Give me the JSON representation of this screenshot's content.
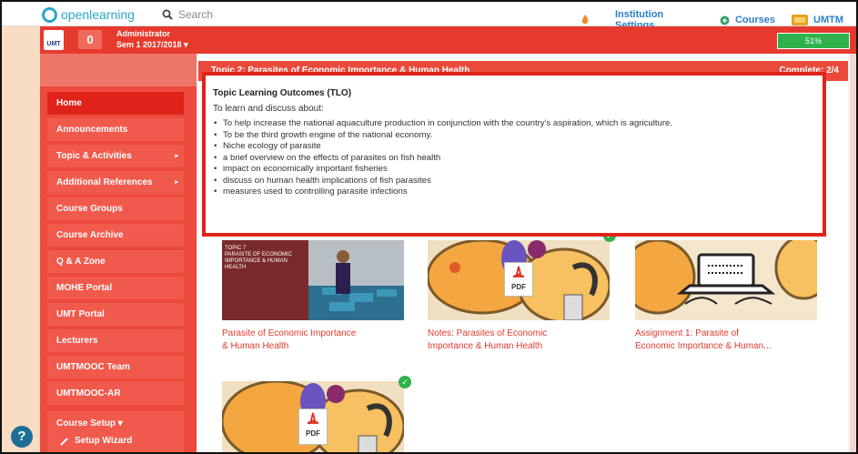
{
  "topbar": {
    "brand": "openlearning",
    "search_placeholder": "Search",
    "institution_settings": "Institution Settings",
    "courses": "Courses",
    "umtm": "UMTM"
  },
  "user": {
    "role": "Administrator",
    "semester": "Sem 1 2017/2018 ▾",
    "notifications": "0",
    "logo_text": "UMT",
    "progress": "51%"
  },
  "sidebar": {
    "items": [
      {
        "label": "Home",
        "active": true
      },
      {
        "label": "Announcements"
      },
      {
        "label": "Topic & Activities",
        "arrow": "▸"
      },
      {
        "label": "Additional References",
        "arrow": "▸"
      },
      {
        "label": "Course Groups"
      },
      {
        "label": "Course Archive"
      },
      {
        "label": "Q & A Zone"
      },
      {
        "label": "MOHE Portal"
      },
      {
        "label": "UMT Portal"
      },
      {
        "label": "Lecturers"
      },
      {
        "label": "UMTMOOC Team"
      },
      {
        "label": "UMTMOOC-AR"
      }
    ],
    "setup": "Course Setup ▾",
    "setup_wizard": "Setup Wizard",
    "help": "?"
  },
  "topic_bar": {
    "title": "Topic 2: Parasites of Economic Importance & Human Health",
    "complete": "Complete: 2/4"
  },
  "tlo": {
    "title": "Topic Learning Outcomes (TLO)",
    "intro": "To learn and discuss about:",
    "items": [
      "To help increase the national aquaculture production in conjunction with the country's aspiration, which is agriculture.",
      "To be the third growth engine of the national economy.",
      "Niche ecology of parasite",
      "a brief overview on the effects of parasites on fish health",
      "impact on economically important fisheries",
      "discuss on human health implications of fish parasites",
      "measures used to controlling parasite infections"
    ]
  },
  "cards": [
    {
      "title_1": "Parasite of Economic Importance",
      "title_2": "& Human Health",
      "slide_title": "TOPIC 7\nPARASITE OF ECONOMIC\nIMPORTANCE & HUMAN HEALTH"
    },
    {
      "title_1": "Notes: Parasites of Economic",
      "title_2": "Importance & Human Health",
      "pdf": "PDF"
    },
    {
      "title_1": "Assignment 1: Parasite of",
      "title_2": "Economic Importance & Human..."
    },
    {
      "pdf": "PDF"
    }
  ],
  "colors": {
    "accent": "#e63a2e",
    "sidebar": "#eb4a3c",
    "highlight_border": "#e0241a",
    "progress": "#2fb24c",
    "brand": "#2ba6c9"
  }
}
